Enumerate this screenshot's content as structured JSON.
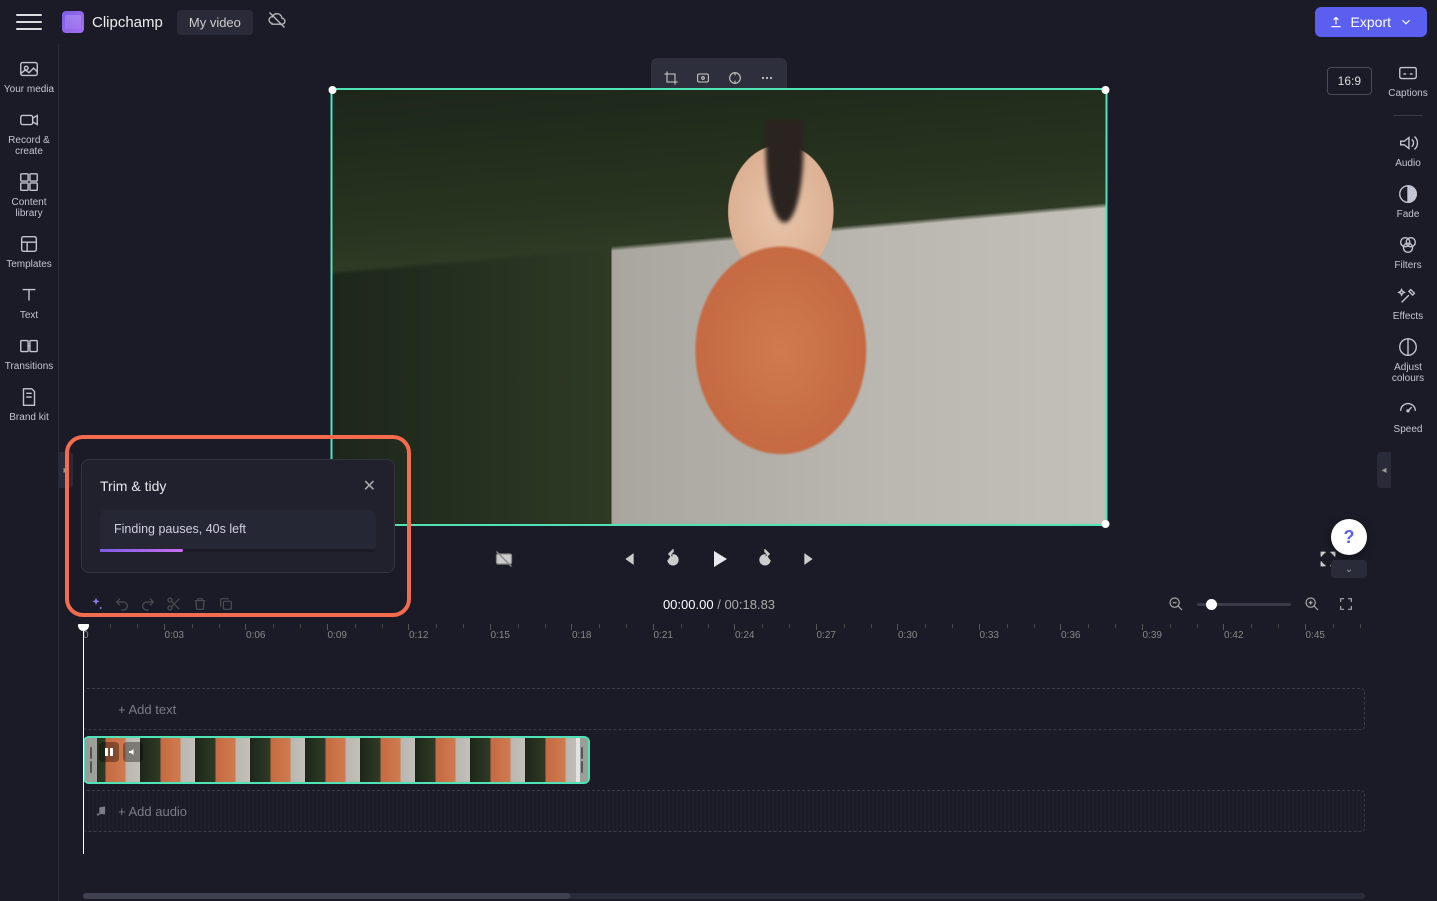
{
  "header": {
    "brand": "Clipchamp",
    "video_title": "My video",
    "export_label": "Export"
  },
  "leftnav": [
    {
      "label": "Your media"
    },
    {
      "label": "Record & create"
    },
    {
      "label": "Content library"
    },
    {
      "label": "Templates"
    },
    {
      "label": "Text"
    },
    {
      "label": "Transitions"
    },
    {
      "label": "Brand kit"
    }
  ],
  "rightnav": [
    {
      "label": "Captions"
    },
    {
      "label": "Audio"
    },
    {
      "label": "Fade"
    },
    {
      "label": "Filters"
    },
    {
      "label": "Effects"
    },
    {
      "label": "Adjust colours"
    },
    {
      "label": "Speed"
    }
  ],
  "preview": {
    "aspect_ratio": "16:9"
  },
  "player": {
    "current_time": "00:00.00",
    "separator": "/",
    "total_time": "00:18.83"
  },
  "timeline": {
    "ticks": [
      "0",
      "0:03",
      "0:06",
      "0:09",
      "0:12",
      "0:15",
      "0:18",
      "0:21",
      "0:24",
      "0:27",
      "0:30",
      "0:33",
      "0:36",
      "0:39",
      "0:42",
      "0:45"
    ],
    "add_text_label": "+ Add text",
    "add_audio_label": "+ Add audio"
  },
  "popup": {
    "title": "Trim & tidy",
    "status": "Finding pauses, 40s left"
  }
}
